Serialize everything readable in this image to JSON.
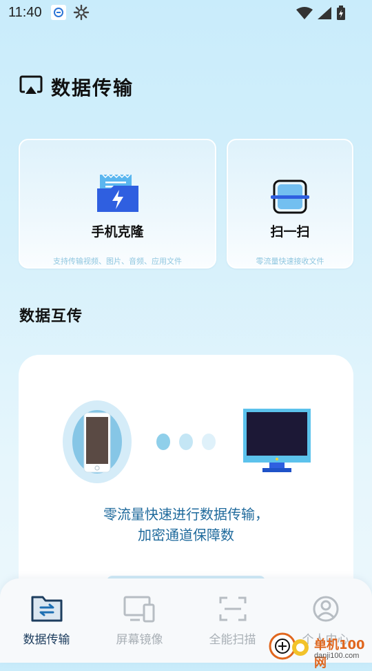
{
  "status_bar": {
    "time": "11:40",
    "icons": [
      "app-notification-icon",
      "gear-icon",
      "wifi-icon",
      "signal-icon",
      "battery-charging-icon"
    ]
  },
  "header": {
    "title": "数据传输",
    "icon": "cast-icon"
  },
  "feature_cards": [
    {
      "title": "手机克隆",
      "subtitle": "支持传输视频、图片、音频、应用文件",
      "icon": "folder-lightning-icon"
    },
    {
      "title": "扫一扫",
      "subtitle": "零流量快速接收文件",
      "icon": "scan-icon"
    }
  ],
  "section": {
    "title": "数据互传"
  },
  "transfer_panel": {
    "description_line1": "零流量快速进行数据传输，",
    "description_line2": "加密通道保障数",
    "colors": {
      "accent": "#1f6a9c",
      "monitor_frame": "#5cc2ec",
      "dot1": "#8fcfea",
      "dot2": "#c4e6f5",
      "dot3": "#dff1fa"
    }
  },
  "bottom_nav": {
    "items": [
      {
        "label": "数据传输",
        "icon": "transfer-folder-icon",
        "active": true
      },
      {
        "label": "屏幕镜像",
        "icon": "screen-mirror-icon",
        "active": false
      },
      {
        "label": "全能扫描",
        "icon": "scan-frame-icon",
        "active": false
      },
      {
        "label": "个人中心",
        "icon": "user-icon",
        "active": false
      }
    ]
  },
  "watermark": {
    "line1": "单机100网",
    "line2": "danji100.com"
  }
}
